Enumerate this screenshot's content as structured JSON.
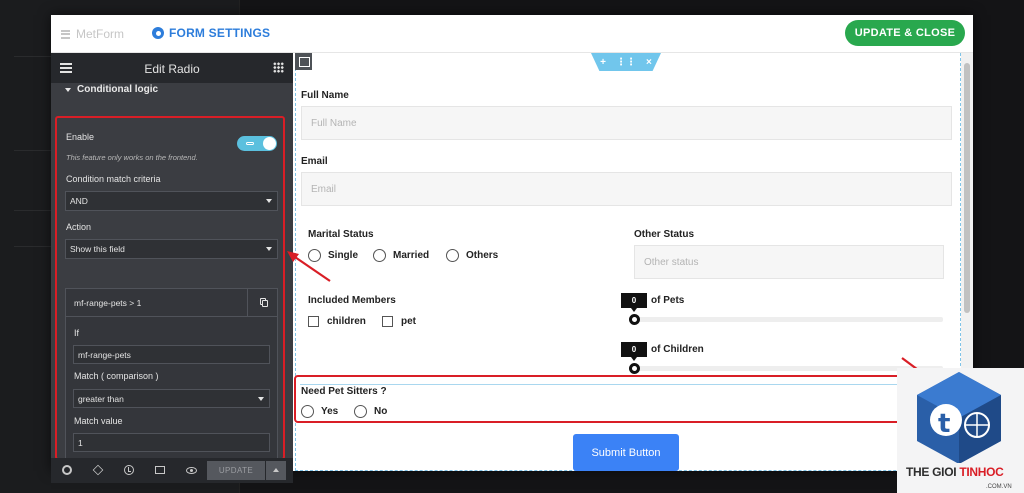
{
  "header": {
    "brand": "MetForm",
    "form_settings": "FORM SETTINGS",
    "update_close": "UPDATE & CLOSE"
  },
  "panel": {
    "title": "Edit Radio",
    "section": "Conditional logic",
    "enable_label": "Enable",
    "enable_on": true,
    "note": "This feature only works on the frontend.",
    "criteria_label": "Condition match criteria",
    "criteria_value": "AND",
    "action_label": "Action",
    "action_value": "Show this field",
    "condition": {
      "title": "mf-range-pets > 1",
      "if_label": "If",
      "if_value": "mf-range-pets",
      "match_label": "Match ( comparison )",
      "match_value": "greater than",
      "value_label": "Match value",
      "value": "1"
    },
    "footer_update": "UPDATE"
  },
  "form": {
    "full_name_label": "Full Name",
    "full_name_placeholder": "Full Name",
    "email_label": "Email",
    "email_placeholder": "Email",
    "marital_label": "Marital Status",
    "marital_options": [
      "Single",
      "Married",
      "Others"
    ],
    "other_status_label": "Other Status",
    "other_status_placeholder": "Other status",
    "members_label": "Included Members",
    "members_options": [
      "children",
      "pet"
    ],
    "pets_value": "0",
    "pets_label": "of Pets",
    "children_value": "0",
    "children_label": "of Children",
    "pet_sitters_label": "Need Pet Sitters ?",
    "pet_sitters_options": [
      "Yes",
      "No"
    ],
    "submit": "Submit Button"
  },
  "watermark": {
    "part1": "THE GIOI ",
    "part2": "TINHOC",
    "sub": ".COM.VN"
  },
  "colors": {
    "accent": "#2d7ddb",
    "update_close": "#29a84e",
    "highlight_red": "#d91e26",
    "submit": "#3b82f6",
    "toggle": "#5bc0de"
  }
}
